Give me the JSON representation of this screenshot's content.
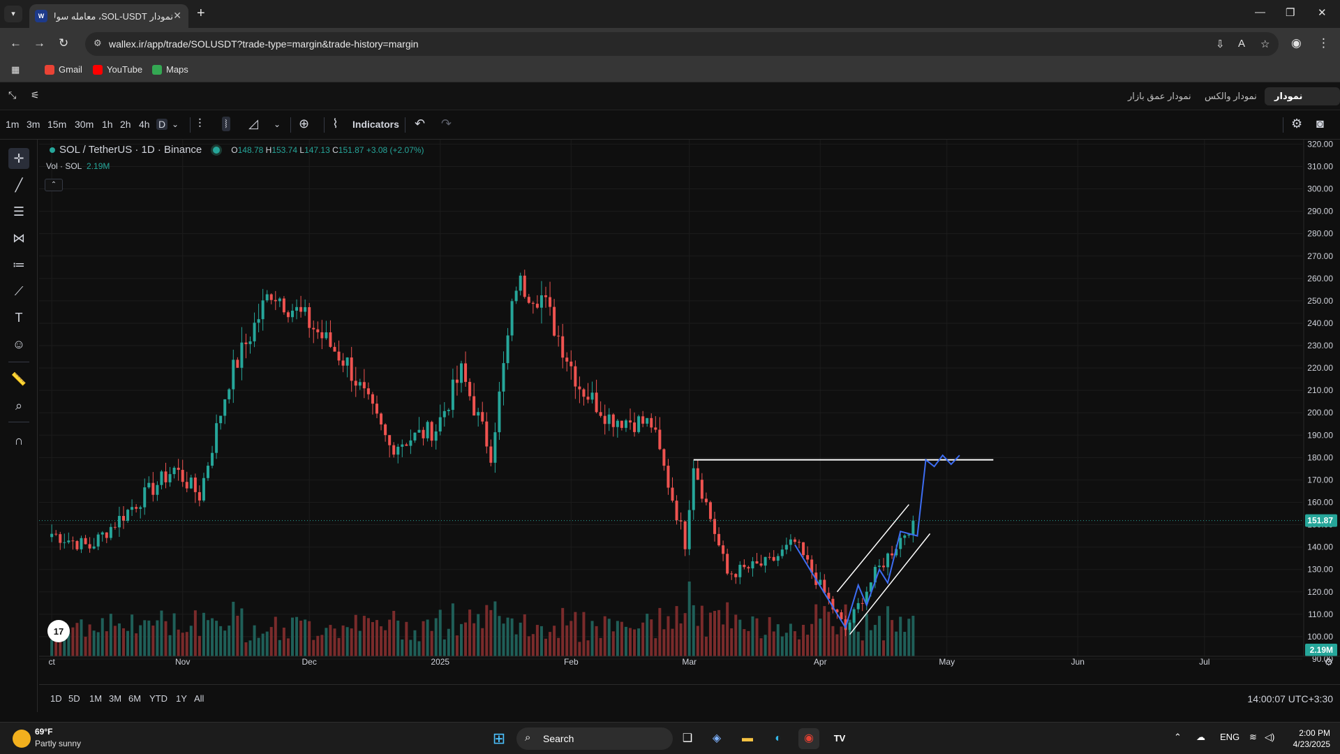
{
  "browser": {
    "tab_title": "نمودار SOL-USDT، معامله سولانا",
    "favicon_text": "W",
    "url": "wallex.ir/app/trade/SOLUSDT?trade-type=margin&trade-history=margin",
    "bookmarks": [
      {
        "label": "Gmail",
        "color": "#ea4335"
      },
      {
        "label": "YouTube",
        "color": "#ff0000"
      },
      {
        "label": "Maps",
        "color": "#34a853"
      }
    ]
  },
  "page": {
    "tabs": [
      {
        "label": "نمودار جهانی",
        "active": true
      },
      {
        "label": "نمودار والکس",
        "active": false
      },
      {
        "label": "نمودار عمق بازار",
        "active": false
      }
    ],
    "timeframes": [
      "1m",
      "3m",
      "15m",
      "30m",
      "1h",
      "2h",
      "4h",
      "D"
    ],
    "selected_timeframe": "D",
    "indicators_label": "Indicators",
    "ranges": [
      "1D",
      "5D",
      "1M",
      "3M",
      "6M",
      "YTD",
      "1Y",
      "All"
    ],
    "clock": "14:00:07 UTC+3:30"
  },
  "legend": {
    "symbol": "SOL / TetherUS · 1D · Binance",
    "o_label": "O",
    "o": "148.78",
    "h_label": "H",
    "h": "153.74",
    "l_label": "L",
    "l": "147.13",
    "c_label": "C",
    "c": "151.87",
    "change": "+3.08 (+2.07%)",
    "vol_label": "Vol · SOL",
    "vol_value": "2.19M"
  },
  "chart_data": {
    "type": "candlestick",
    "title": "SOL / TetherUS · 1D · Binance",
    "ylim": [
      85,
      322
    ],
    "y_ticks": [
      90,
      100,
      110,
      120,
      130,
      140,
      150,
      160,
      170,
      180,
      190,
      200,
      210,
      220,
      230,
      240,
      250,
      260,
      270,
      280,
      290,
      300,
      310,
      320
    ],
    "x_tick_labels": [
      "ct",
      "Nov",
      "Dec",
      "2025",
      "Feb",
      "Mar",
      "Apr",
      "May",
      "Jun",
      "Jul"
    ],
    "last_price": "151.87",
    "last_volume": "2.19M",
    "up_color": "#26a69a",
    "down_color": "#ef5350",
    "close_series_keypoints": [
      {
        "date": "2024-10-01",
        "close": 146
      },
      {
        "date": "2024-10-10",
        "close": 140
      },
      {
        "date": "2024-10-20",
        "close": 158
      },
      {
        "date": "2024-10-30",
        "close": 175
      },
      {
        "date": "2024-11-05",
        "close": 163
      },
      {
        "date": "2024-11-12",
        "close": 215
      },
      {
        "date": "2024-11-22",
        "close": 255
      },
      {
        "date": "2024-12-01",
        "close": 240
      },
      {
        "date": "2024-12-10",
        "close": 222
      },
      {
        "date": "2024-12-20",
        "close": 185
      },
      {
        "date": "2024-12-31",
        "close": 193
      },
      {
        "date": "2025-01-06",
        "close": 218
      },
      {
        "date": "2025-01-13",
        "close": 182
      },
      {
        "date": "2025-01-19",
        "close": 258
      },
      {
        "date": "2025-01-25",
        "close": 252
      },
      {
        "date": "2025-02-03",
        "close": 212
      },
      {
        "date": "2025-02-10",
        "close": 198
      },
      {
        "date": "2025-02-20",
        "close": 195
      },
      {
        "date": "2025-02-28",
        "close": 142
      },
      {
        "date": "2025-03-02",
        "close": 178
      },
      {
        "date": "2025-03-10",
        "close": 128
      },
      {
        "date": "2025-03-20",
        "close": 133
      },
      {
        "date": "2025-03-26",
        "close": 142
      },
      {
        "date": "2025-04-07",
        "close": 103
      },
      {
        "date": "2025-04-14",
        "close": 128
      },
      {
        "date": "2025-04-23",
        "close": 151.87
      }
    ],
    "drawings": {
      "resistance_level": 179,
      "channel_upper": [
        {
          "date": "2025-04-05",
          "price": 120
        },
        {
          "date": "2025-04-22",
          "price": 159
        }
      ],
      "channel_lower": [
        {
          "date": "2025-04-08",
          "price": 101
        },
        {
          "date": "2025-04-27",
          "price": 146
        }
      ],
      "projection_path": [
        {
          "date": "2025-03-26",
          "price": 141
        },
        {
          "date": "2025-04-07",
          "price": 104
        },
        {
          "date": "2025-04-10",
          "price": 123
        },
        {
          "date": "2025-04-12",
          "price": 114
        },
        {
          "date": "2025-04-15",
          "price": 130
        },
        {
          "date": "2025-04-17",
          "price": 124
        },
        {
          "date": "2025-04-20",
          "price": 147
        },
        {
          "date": "2025-04-24",
          "price": 145
        },
        {
          "date": "2025-04-26",
          "price": 179
        },
        {
          "date": "2025-04-28",
          "price": 176
        },
        {
          "date": "2025-04-30",
          "price": 181
        },
        {
          "date": "2025-05-02",
          "price": 177
        },
        {
          "date": "2025-05-04",
          "price": 181
        }
      ]
    }
  },
  "taskbar": {
    "temp": "69°F",
    "weather": "Partly sunny",
    "search": "Search",
    "lang": "ENG",
    "time": "2:00 PM",
    "date": "4/23/2025"
  }
}
